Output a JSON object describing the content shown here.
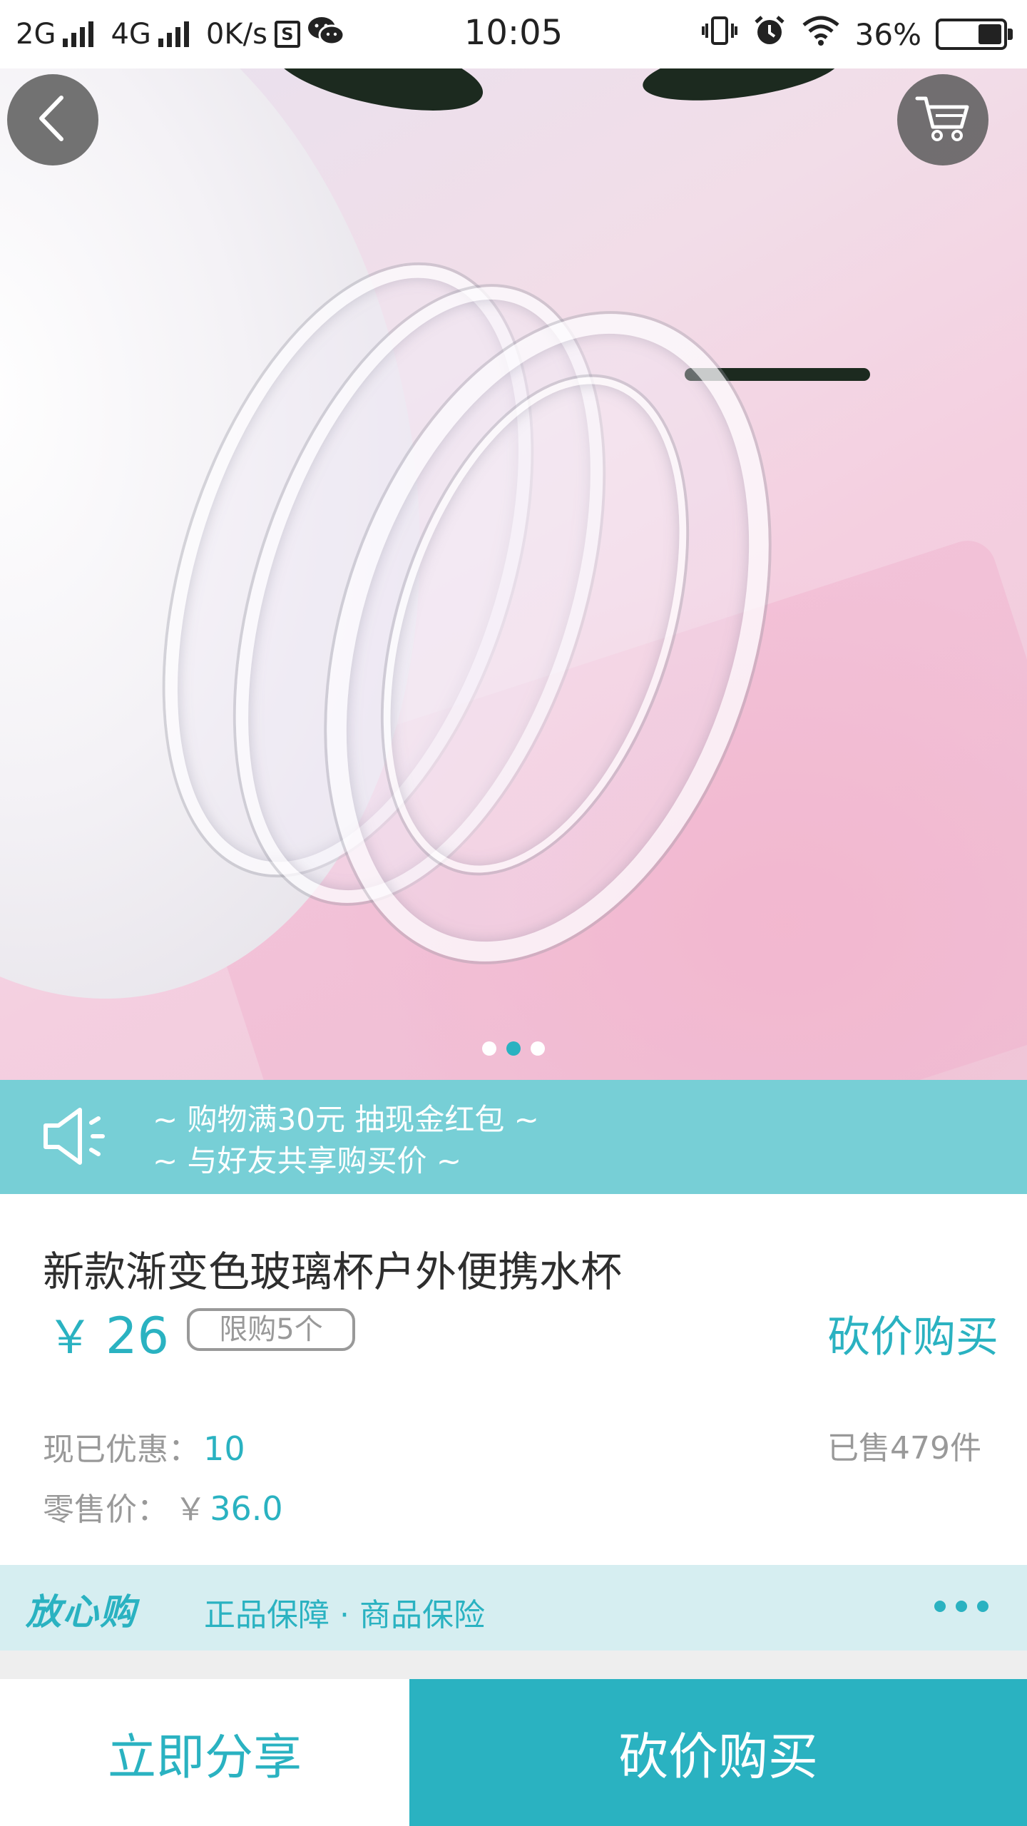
{
  "status_bar": {
    "network1": "2G",
    "network2": "4G",
    "speed": "0K/s",
    "sim_icon_text": "S",
    "time": "10:05",
    "battery": "36%",
    "icons": [
      "signal-icon",
      "sim-icon",
      "wechat-icon",
      "vibrate-icon",
      "alarm-icon",
      "wifi-icon",
      "battery-icon"
    ]
  },
  "hero": {
    "carousel": {
      "count": 3,
      "active_index": 1
    },
    "back_icon": "chevron-left-icon",
    "cart_icon": "cart-icon"
  },
  "promo": {
    "icon": "speaker-icon",
    "line1": "~ 购物满30元 抽现金红包 ~",
    "line2": "~ 与好友共享购买价 ~"
  },
  "product": {
    "title": "新款渐变色玻璃杯户外便携水杯",
    "currency": "￥",
    "price": "26",
    "limit_badge": "限购5个",
    "bargain_link": "砍价购买",
    "discount_label": "现已优惠：",
    "discount_value": "10",
    "retail_label": "零售价：",
    "retail_currency": "￥",
    "retail_value": "36.0",
    "sold": "已售479件"
  },
  "assurance": {
    "brand": "放心购",
    "text": "正品保障 · 商品保险",
    "more_icon": "more-dots-icon"
  },
  "actions": {
    "share": "立即分享",
    "bargain_buy": "砍价购买"
  },
  "colors": {
    "accent": "#2ab2c1",
    "promo_bg": "#77cfd6",
    "assurance_bg": "#d6eef1"
  }
}
